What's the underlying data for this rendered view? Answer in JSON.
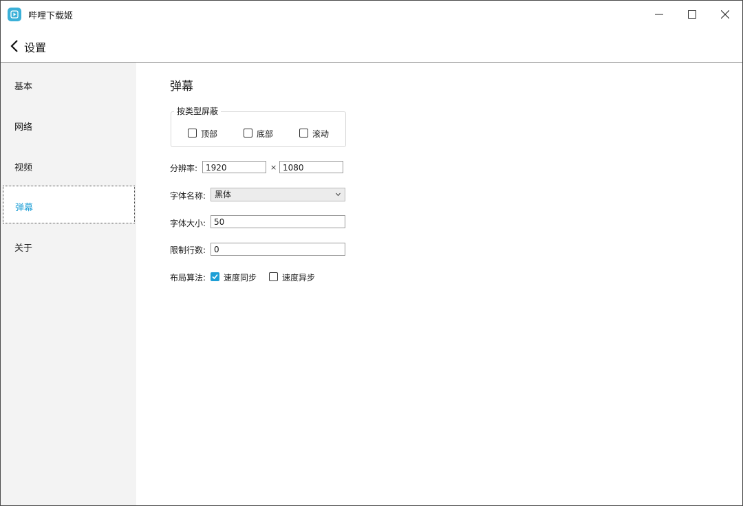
{
  "app": {
    "title": "哔哩下载姬"
  },
  "header": {
    "back_label": "设置"
  },
  "sidebar": {
    "items": [
      {
        "label": "基本"
      },
      {
        "label": "网络"
      },
      {
        "label": "视频"
      },
      {
        "label": "弹幕"
      },
      {
        "label": "关于"
      }
    ],
    "selected": "弹幕"
  },
  "danmaku": {
    "section_title": "弹幕",
    "block_group": {
      "legend": "按类型屏蔽",
      "top_label": "顶部",
      "top_checked": false,
      "bottom_label": "底部",
      "bottom_checked": false,
      "scroll_label": "滚动",
      "scroll_checked": false
    },
    "resolution": {
      "label": "分辨率:",
      "width": "1920",
      "separator": "×",
      "height": "1080"
    },
    "font_name": {
      "label": "字体名称:",
      "value": "黑体"
    },
    "font_size": {
      "label": "字体大小:",
      "value": "50"
    },
    "line_limit": {
      "label": "限制行数:",
      "value": "0"
    },
    "layout": {
      "label": "布局算法:",
      "sync_label": "速度同步",
      "sync_checked": true,
      "async_label": "速度异步",
      "async_checked": false
    }
  },
  "colors": {
    "accent": "#1e9fd6",
    "sidebar_bg": "#f3f3f3",
    "icon_bg": "#3bb0d8"
  }
}
